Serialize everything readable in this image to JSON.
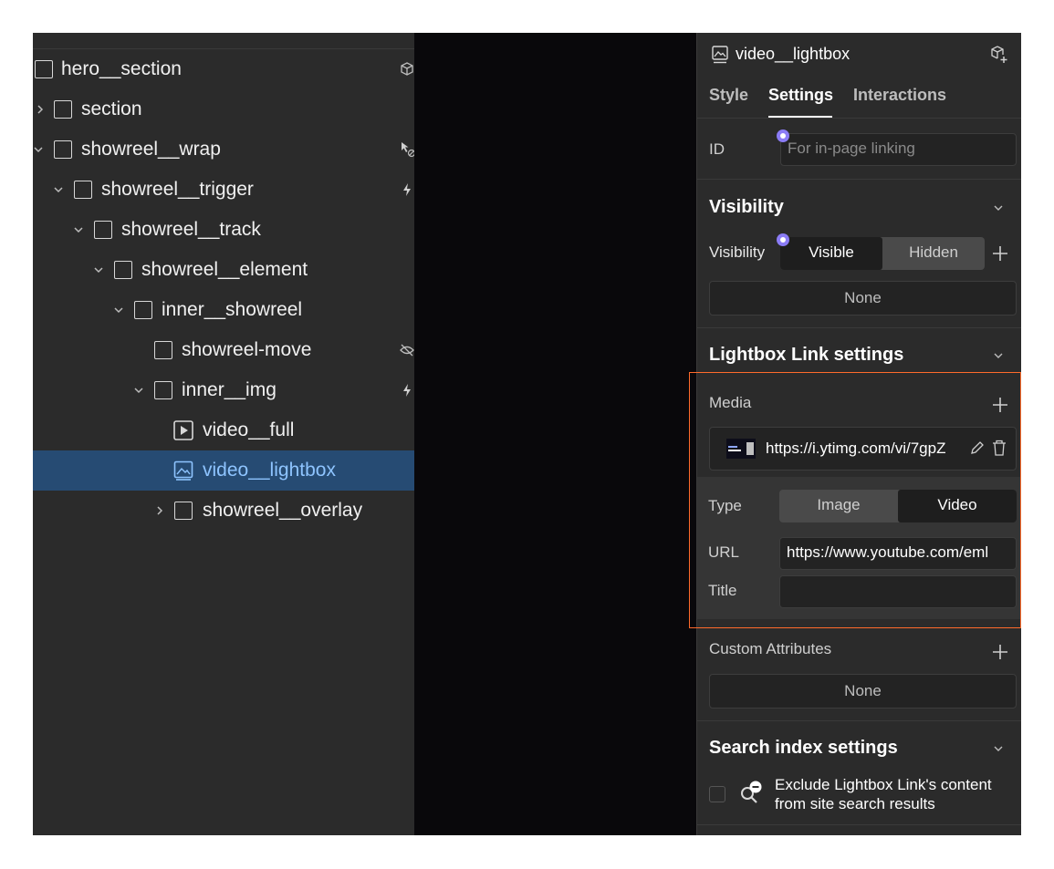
{
  "navigator": {
    "items": [
      {
        "label": "hero__section",
        "icon": "cube-icon"
      },
      {
        "label": "section"
      },
      {
        "label": "showreel__wrap",
        "icon": "cursor-off-icon"
      },
      {
        "label": "showreel__trigger",
        "icon": "lightning-icon"
      },
      {
        "label": "showreel__track"
      },
      {
        "label": "showreel__element"
      },
      {
        "label": "inner__showreel"
      },
      {
        "label": "showreel-move",
        "icon": "eye-off-icon"
      },
      {
        "label": "inner__img",
        "icon": "lightning-icon"
      },
      {
        "label": "video__full"
      },
      {
        "label": "video__lightbox",
        "selected": true
      },
      {
        "label": "showreel__overlay"
      }
    ]
  },
  "panel": {
    "element_name": "video__lightbox",
    "tabs": [
      "Style",
      "Settings",
      "Interactions"
    ],
    "active_tab": "Settings",
    "id_label": "ID",
    "id_placeholder": "For in-page linking",
    "visibility": {
      "title": "Visibility",
      "label": "Visibility",
      "options": [
        "Visible",
        "Hidden"
      ],
      "selected": "Visible",
      "conditions": "None"
    },
    "lightbox": {
      "title": "Lightbox Link settings",
      "media_label": "Media",
      "media_url": "https://i.ytimg.com/vi/7gpZ",
      "type_label": "Type",
      "type_options": [
        "Image",
        "Video"
      ],
      "type_selected": "Video",
      "url_label": "URL",
      "url_value": "https://www.youtube.com/eml",
      "title_label": "Title",
      "title_value": ""
    },
    "custom_attributes": {
      "label": "Custom Attributes",
      "value": "None"
    },
    "search_index": {
      "title": "Search index settings",
      "exclude_line1": "Exclude Lightbox Link's content",
      "exclude_line2": "from site search results",
      "checked": false
    }
  },
  "colors": {
    "panel_bg": "#2b2b2b",
    "canvas_bg": "#09080b",
    "selection_bg": "#264b73",
    "selection_text": "#8ec4ff",
    "highlight_border": "#ff6a2b",
    "badge_purple": "#8b7cf6"
  }
}
